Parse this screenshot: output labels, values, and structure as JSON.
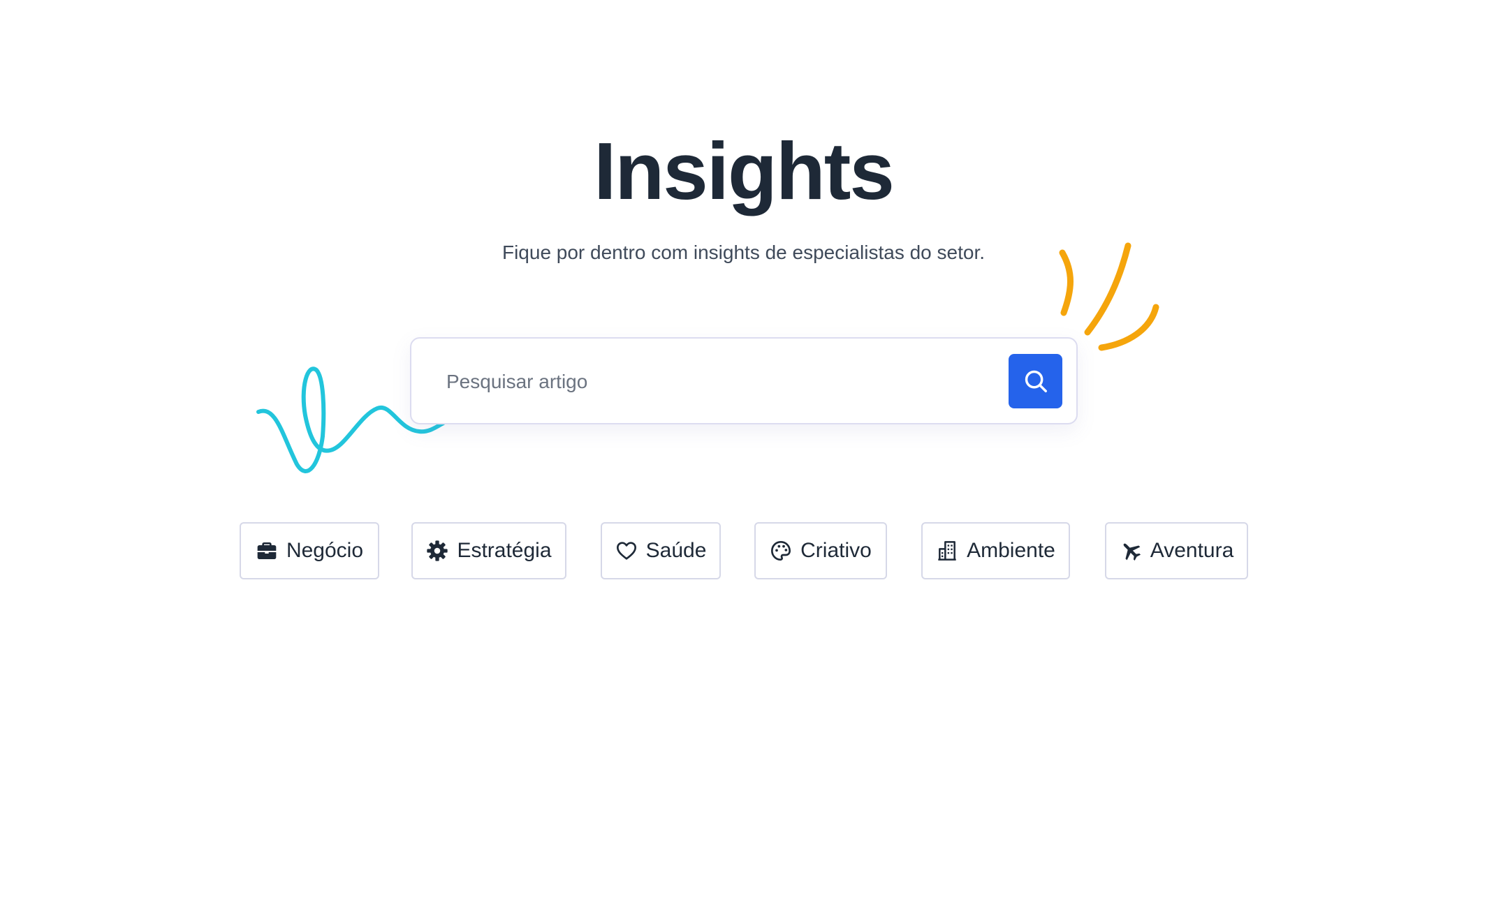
{
  "hero": {
    "title": "Insights",
    "subtitle": "Fique por dentro com insights de especialistas do setor."
  },
  "search": {
    "placeholder": "Pesquisar artigo",
    "value": "",
    "button_icon": "search-icon",
    "button_color": "#2563eb"
  },
  "categories": [
    {
      "label": "Negócio",
      "icon": "briefcase-icon"
    },
    {
      "label": "Estratégia",
      "icon": "gear-icon"
    },
    {
      "label": "Saúde",
      "icon": "heart-icon"
    },
    {
      "label": "Criativo",
      "icon": "palette-icon"
    },
    {
      "label": "Ambiente",
      "icon": "building-icon"
    },
    {
      "label": "Aventura",
      "icon": "airplane-icon"
    }
  ],
  "colors": {
    "title": "#1e2937",
    "accent": "#2563eb",
    "doodle_teal": "#22c5dc",
    "doodle_orange": "#f5a50c"
  }
}
